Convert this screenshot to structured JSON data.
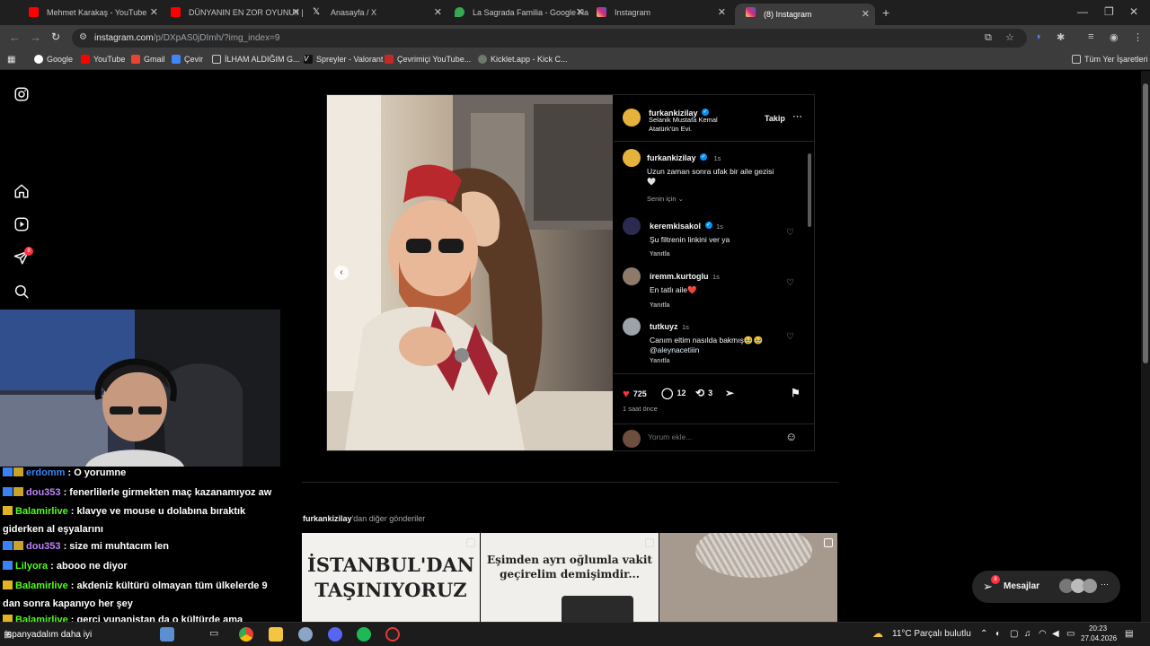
{
  "tabs": [
    {
      "title": "Mehmet Karakaş - YouTube",
      "color": "#ff0000"
    },
    {
      "title": "DÜNYANIN EN ZOR OYUNU!! |",
      "color": "#ff0000"
    },
    {
      "title": "Anasayfa / X",
      "color": "#ffffff"
    },
    {
      "title": "La Sagrada Familia - Google Ha",
      "color": "#34a853"
    },
    {
      "title": "Instagram",
      "color": "#e1306c"
    },
    {
      "title": "(8) Instagram",
      "color": "#e1306c",
      "active": true
    }
  ],
  "address": {
    "host": "instagram.com",
    "path": "/p/DXpAS0jDImh/?img_index=9"
  },
  "bookmarks": [
    "Google",
    "YouTube",
    "Gmail",
    "Çevir",
    "İLHAM ALDIĞIM G...",
    "Spreyler - Valorant",
    "Çevrimiçi YouTube...",
    "Kicklet.app - Kick C..."
  ],
  "all_bookmarks": "Tüm Yer İşaretleri",
  "sidebar": {
    "notification_count": "8"
  },
  "post": {
    "author": "furkankizilay",
    "location": "Selanik Mustafa Kemal Atatürk'ün Evi.",
    "follow_label": "Takip",
    "caption_user": "furkankizilay",
    "caption_time": "1s",
    "caption_text": "Uzun zaman sonra ufak bir aile gezisi",
    "caption_heart": "🤍",
    "for_you": "Senin için",
    "comments": [
      {
        "user": "keremkisakol",
        "time": "1s",
        "text": "Şu filtrenin linkini ver ya",
        "reply": "Yanıtla",
        "verified": true
      },
      {
        "user": "iremm.kurtoglu",
        "time": "1s",
        "text": "En tatlı aile",
        "emoji": "❤️",
        "reply": "Yanıtla"
      },
      {
        "user": "tutkuyz",
        "time": "1s",
        "text": "Canım eltim nasılda bakmış🥹🥹",
        "mention": "@aleynacetiiin",
        "reply": "Yanıtla"
      }
    ],
    "likes": "725",
    "comment_count": "12",
    "reposts": "3",
    "posted_ago": "1 saat önce",
    "add_comment_placeholder": "Yorum ekle..."
  },
  "more_posts": {
    "user": "furkankizilay",
    "suffix": "'dan diğer gönderiler",
    "items": [
      {
        "caption": "İSTANBUL'DAN TAŞINIYORUZ"
      },
      {
        "caption": "Eşimden ayrı oğlumla vakit geçirelim demişimdir..."
      },
      {
        "caption": ""
      }
    ]
  },
  "messages": {
    "label": "Mesajlar",
    "badge": "8"
  },
  "chat": [
    {
      "user": "erdomm",
      "msg": ": O yorumne",
      "color": "#3b82f6"
    },
    {
      "user": "dou353",
      "msg": ": fenerlilerle girmekten maç kazanamıyoz aw",
      "color": "#c084fc"
    },
    {
      "user": "Balamirlive",
      "msg": ": klavye ve mouse u dolabına bıraktık giderken al eşyalarını",
      "color": "#53fc18"
    },
    {
      "user": "dou353",
      "msg": ": size mi muhtacım len",
      "color": "#c084fc"
    },
    {
      "user": "Lilyora",
      "msg": ": abooo ne diyor",
      "color": "#53fc18"
    },
    {
      "user": "Balamirlive",
      "msg": ": akdeniz kültürü olmayan tüm ülkelerde 9 dan sonra kapanıyo her şey",
      "color": "#53fc18"
    },
    {
      "user": "Balamirlive",
      "msg": ": gerçi yunanistan da o kültürde ama",
      "color": "#53fc18"
    }
  ],
  "taskbar": {
    "weather": "11°C  Parçalı bulutlu",
    "time": "20:23",
    "date": "27.04.2026",
    "search_text": "ispanyadalım daha iyi"
  }
}
